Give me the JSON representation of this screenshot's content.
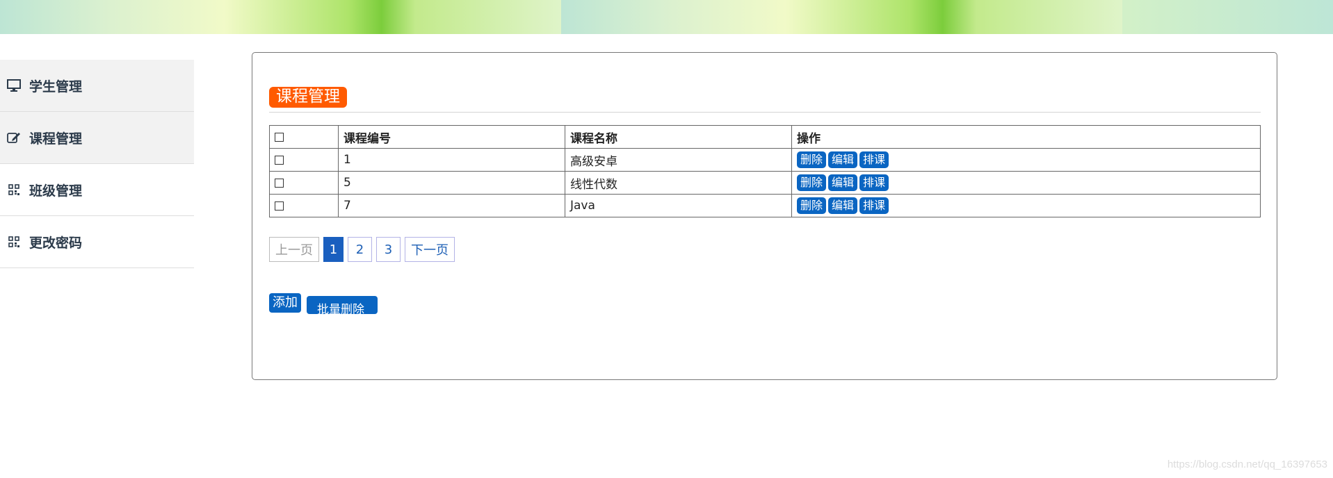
{
  "sidebar": {
    "items": [
      {
        "label": "学生管理",
        "icon": "monitor-icon"
      },
      {
        "label": "课程管理",
        "icon": "edit-icon"
      },
      {
        "label": "班级管理",
        "icon": "qrcode-icon"
      },
      {
        "label": "更改密码",
        "icon": "qrcode-icon"
      }
    ]
  },
  "main": {
    "title": "课程管理",
    "table": {
      "headers": [
        "课程编号",
        "课程名称",
        "操作"
      ],
      "rows": [
        {
          "id": "1",
          "name": "高级安卓"
        },
        {
          "id": "5",
          "name": "线性代数"
        },
        {
          "id": "7",
          "name": "Java"
        }
      ],
      "actions": {
        "delete": "删除",
        "edit": "编辑",
        "schedule": "排课"
      }
    },
    "pagination": {
      "prev": "上一页",
      "pages": [
        "1",
        "2",
        "3"
      ],
      "current": "1",
      "next": "下一页"
    },
    "buttons": {
      "add": "添加",
      "bulk_delete": "批量删除"
    }
  },
  "watermark": "https://blog.csdn.net/qq_16397653",
  "colors": {
    "title_badge": "#ff5a00",
    "primary": "#0a65c2",
    "active_page": "#1a5fbf"
  }
}
